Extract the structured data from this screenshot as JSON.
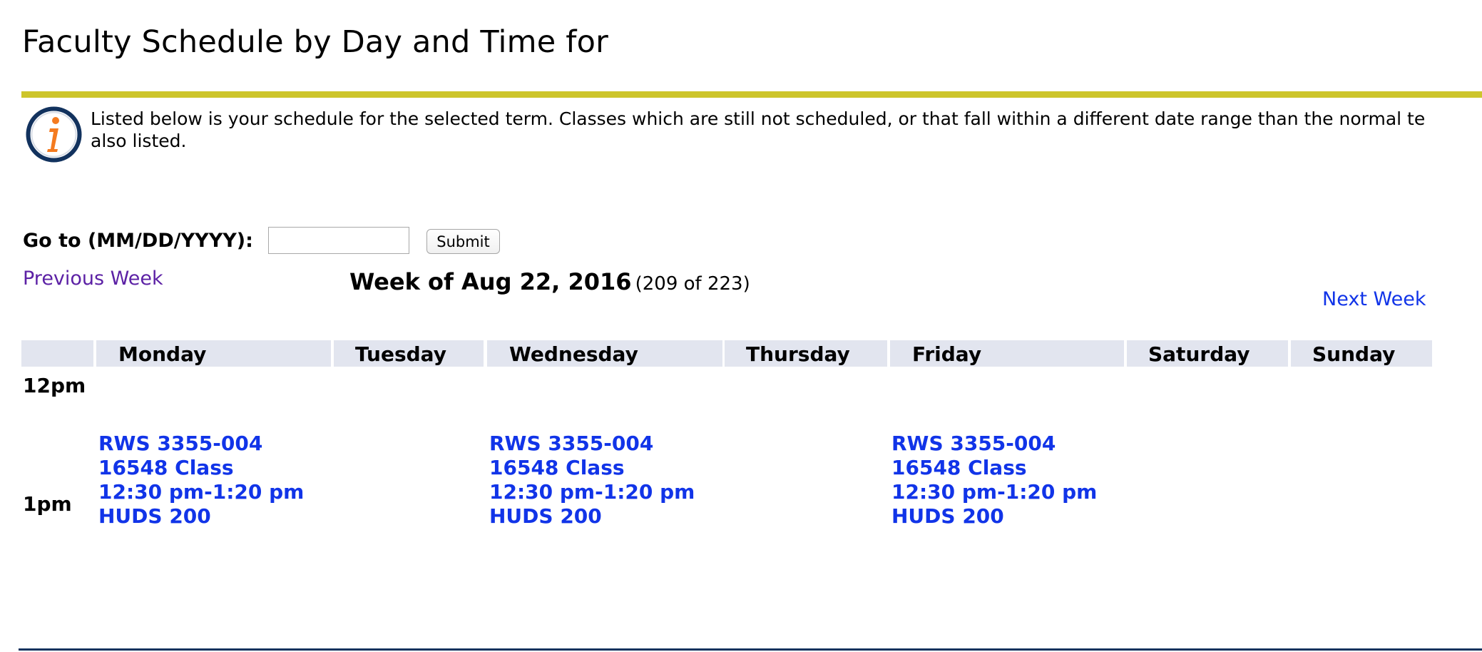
{
  "page": {
    "title": "Faculty Schedule by Day and Time for"
  },
  "info": {
    "icon": "info-icon",
    "line1": "Listed below is your schedule for the selected term. Classes which are still not scheduled, or that fall within a different date range than the normal te",
    "line2": "also listed."
  },
  "goto": {
    "label": "Go to (MM/DD/YYYY):",
    "value": "",
    "placeholder": "",
    "submit_label": "Submit"
  },
  "navigation": {
    "previous_label": "Previous Week",
    "next_label": "Next Week"
  },
  "week": {
    "title": "Week of Aug 22, 2016",
    "count": "(209 of 223)"
  },
  "days": [
    "Monday",
    "Tuesday",
    "Wednesday",
    "Thursday",
    "Friday",
    "Saturday",
    "Sunday"
  ],
  "times": [
    "12pm",
    "1pm"
  ],
  "classes": [
    {
      "day": "Monday",
      "course": "RWS 3355-004",
      "crn": "16548 Class",
      "time": "12:30 pm-1:20 pm",
      "room": "HUDS 200"
    },
    {
      "day": "Wednesday",
      "course": "RWS 3355-004",
      "crn": "16548 Class",
      "time": "12:30 pm-1:20 pm",
      "room": "HUDS 200"
    },
    {
      "day": "Friday",
      "course": "RWS 3355-004",
      "crn": "16548 Class",
      "time": "12:30 pm-1:20 pm",
      "room": "HUDS 200"
    }
  ],
  "colors": {
    "accent_rule": "#cdc52b",
    "header_bg": "#e2e5ef",
    "link": "#1134e8",
    "visited_link": "#5c21a5",
    "footer_rule": "#12325e",
    "icon_ring": "#12325e",
    "icon_glyph": "#f47b20"
  }
}
